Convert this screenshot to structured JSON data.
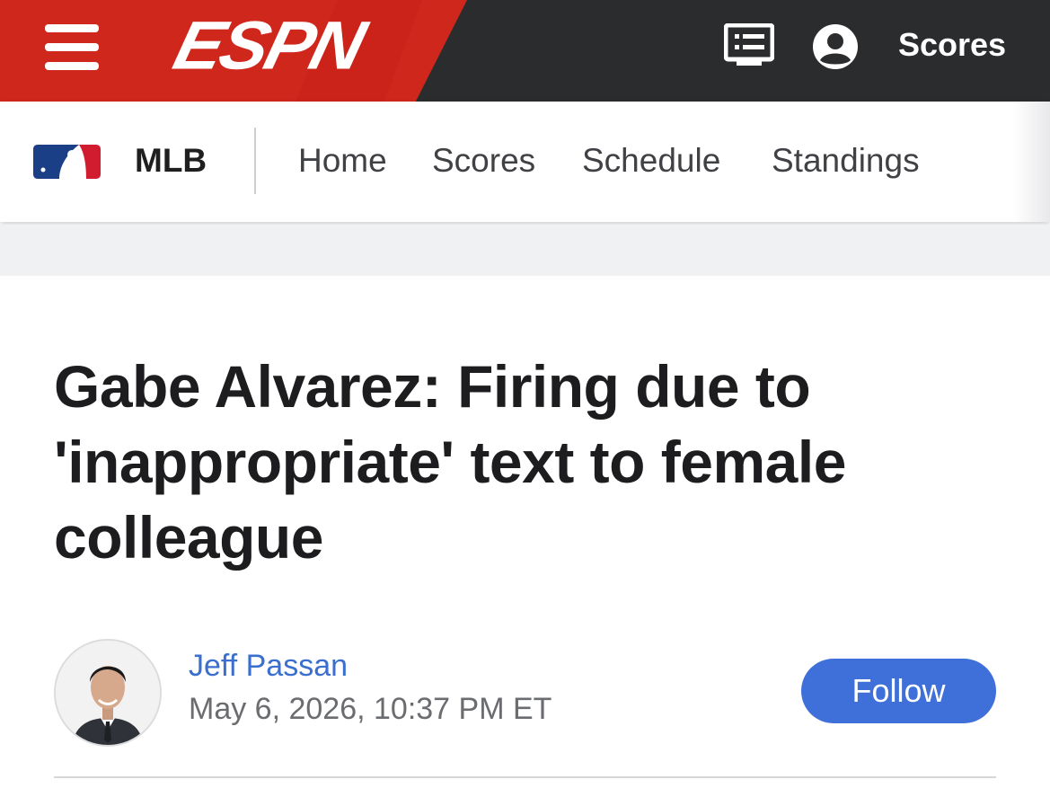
{
  "header": {
    "logo_text": "ESPN",
    "menu_icon": "hamburger-icon",
    "watch_icon": "list-screen-icon",
    "account_icon": "user-circle-icon",
    "scores_label": "Scores",
    "colors": {
      "red": "#d0271d",
      "dark": "#2b2c2d"
    }
  },
  "subnav": {
    "league_logo": "mlb-logo",
    "league": "MLB",
    "links": [
      "Home",
      "Scores",
      "Schedule",
      "Standings"
    ]
  },
  "article": {
    "headline": "Gabe Alvarez: Firing due to 'inappropriate' text to female colleague",
    "author": "Jeff Passan",
    "date": "May 6, 2026, 10:37 PM ET",
    "follow_label": "Follow",
    "colors": {
      "author_link": "#3a6fcf",
      "follow_button": "#3f6fd8"
    }
  }
}
